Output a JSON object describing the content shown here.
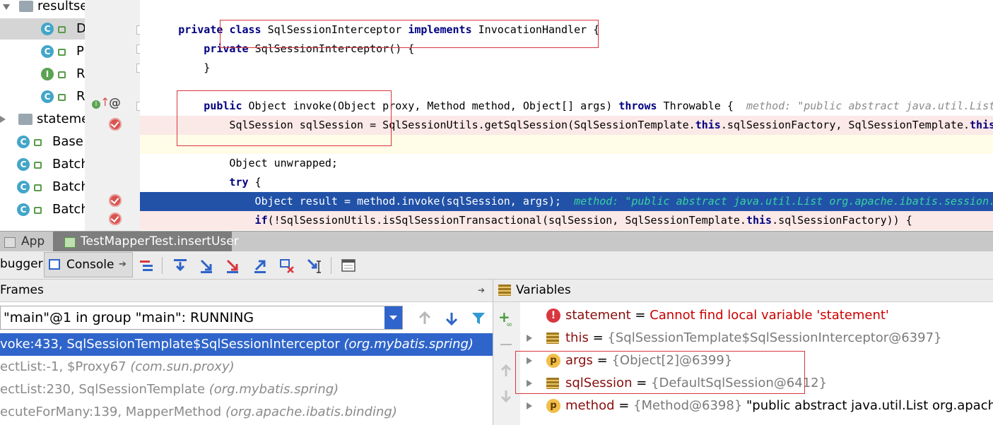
{
  "project_tree": {
    "items": [
      {
        "label": "resultse",
        "kind": "folder"
      },
      {
        "label": "D",
        "kind": "class",
        "selected": true
      },
      {
        "label": "P",
        "kind": "class"
      },
      {
        "label": "R",
        "kind": "interface"
      },
      {
        "label": "R",
        "kind": "class"
      },
      {
        "label": "stateme",
        "kind": "folder"
      },
      {
        "label": "Base",
        "kind": "class"
      },
      {
        "label": "Batch",
        "kind": "class"
      },
      {
        "label": "Batch",
        "kind": "class"
      },
      {
        "label": "Batch",
        "kind": "class"
      }
    ]
  },
  "editor": {
    "lines": [
      {
        "parts": [
          [
            "kw",
            "private "
          ],
          [
            "kw",
            "class "
          ],
          [
            "",
            "SqlSessionInterceptor "
          ],
          [
            "kw",
            "implements "
          ],
          [
            "",
            "InvocationHandler {"
          ]
        ]
      },
      {
        "parts": [
          [
            "kw",
            "    private "
          ],
          [
            "",
            "SqlSessionInterceptor() {"
          ]
        ]
      },
      {
        "parts": [
          [
            "",
            "    }"
          ]
        ]
      },
      {
        "parts": [
          [
            "",
            ""
          ]
        ]
      },
      {
        "parts": [
          [
            "kw",
            "    public "
          ],
          [
            "",
            "Object invoke(Object proxy, Method method, Object[] args) "
          ],
          [
            "kw",
            "throws "
          ],
          [
            "",
            "Throwable {  "
          ],
          [
            "cm",
            "method: \"public abstract java.util.List"
          ]
        ]
      },
      {
        "parts": [
          [
            "",
            "        SqlSession sqlSession = SqlSessionUtils.getSqlSession(SqlSessionTemplate."
          ],
          [
            "kw",
            "this"
          ],
          [
            "",
            ".sqlSessionFactory, SqlSessionTemplate."
          ],
          [
            "kw",
            "this"
          ],
          [
            "",
            "."
          ]
        ]
      },
      {
        "parts": [
          [
            "",
            ""
          ]
        ]
      },
      {
        "parts": [
          [
            "",
            "        Object unwrapped;"
          ]
        ]
      },
      {
        "parts": [
          [
            "kw",
            "        try "
          ],
          [
            "",
            "{"
          ]
        ]
      },
      {
        "parts": [
          [
            "",
            "            Object result = method.invoke(sqlSession, args);  "
          ],
          [
            "dbg",
            "method: \"public abstract java.util.List org.apache.ibatis.session.S"
          ]
        ]
      },
      {
        "parts": [
          [
            "kw",
            "            if"
          ],
          [
            "",
            "(!SqlSessionUtils.isSqlSessionTransactional(sqlSession, SqlSessionTemplate."
          ],
          [
            "kw",
            "this"
          ],
          [
            "",
            ".sqlSessionFactory)) {"
          ]
        ]
      }
    ]
  },
  "tabs": {
    "app": "App",
    "run_config": "TestMapperTest.insertUser"
  },
  "debugger_tabs": {
    "debugger": "bugger",
    "console": "Console"
  },
  "frames": {
    "header": "Frames",
    "thread": "\"main\"@1 in group \"main\": RUNNING",
    "rows": [
      {
        "method": "voke:433, SqlSessionTemplate$SqlSessionInterceptor ",
        "pkg": "(org.mybatis.spring)",
        "selected": true
      },
      {
        "method": "ectList:-1, $Proxy67 ",
        "pkg": "(com.sun.proxy)"
      },
      {
        "method": "ectList:230, SqlSessionTemplate ",
        "pkg": "(org.mybatis.spring)"
      },
      {
        "method": "ecuteForMany:139, MapperMethod ",
        "pkg": "(org.apache.ibatis.binding)"
      }
    ]
  },
  "variables": {
    "header": "Variables",
    "rows": [
      {
        "icon": "error",
        "name": "statement",
        "eq": " = ",
        "value": "Cannot find local variable 'statement'",
        "value_kind": "error"
      },
      {
        "icon": "field",
        "name": "this",
        "eq": " = ",
        "value": "{SqlSessionTemplate$SqlSessionInterceptor@6397}",
        "value_kind": "ref"
      },
      {
        "icon": "param",
        "name": "args",
        "eq": " = ",
        "value": "{Object[2]@6399}",
        "value_kind": "ref"
      },
      {
        "icon": "field",
        "name": "sqlSession",
        "eq": " = ",
        "value": "{DefaultSqlSession@6412}",
        "value_kind": "ref"
      },
      {
        "icon": "param",
        "name": "method",
        "eq": " = ",
        "value": "{Method@6398} ",
        "extra": "\"public abstract java.util.List org.apache.iba",
        "value_kind": "ref"
      }
    ]
  },
  "colors": {
    "selection_blue": "#2f65ca",
    "debug_line": "#2152a8",
    "breakpoint_red": "#d9534f",
    "annotation_box": "#d9363e"
  }
}
